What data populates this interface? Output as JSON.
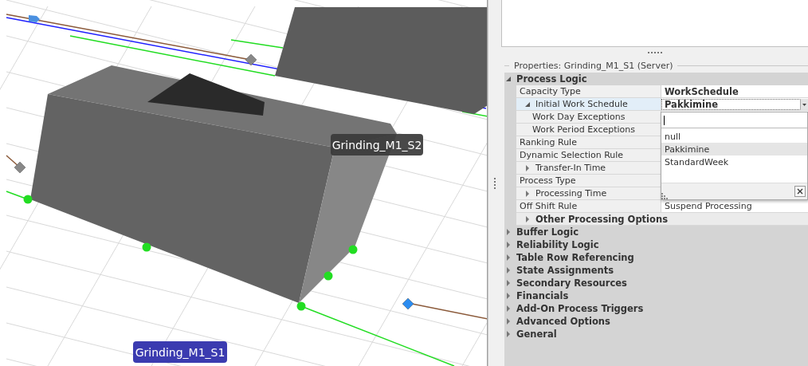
{
  "viewport": {
    "labels": [
      {
        "text": "Grinding_M1_S2",
        "selected": false
      },
      {
        "text": "Grinding_M1_S1",
        "selected": true
      }
    ]
  },
  "properties": {
    "title": "Properties: Grinding_M1_S1 (Server)",
    "categories": [
      {
        "label": "Process Logic",
        "expanded": true,
        "rows": [
          {
            "kind": "property",
            "label": "Capacity Type",
            "value": "WorkSchedule",
            "modified": true,
            "selected": false
          },
          {
            "kind": "property",
            "label": "Initial Work Schedule",
            "value": "Pakkimine",
            "modified": true,
            "selected": true,
            "expanded": true,
            "children": [
              {
                "kind": "property",
                "label": "Work Day Exceptions",
                "selected": false
              },
              {
                "kind": "property",
                "label": "Work Period Exceptions",
                "selected": false
              }
            ]
          },
          {
            "kind": "property",
            "label": "Ranking Rule",
            "selected": false
          },
          {
            "kind": "property",
            "label": "Dynamic Selection Rule",
            "selected": false
          },
          {
            "kind": "property",
            "label": "Transfer-In Time",
            "selected": false,
            "expanded": false
          },
          {
            "kind": "property",
            "label": "Process Type",
            "selected": false
          },
          {
            "kind": "property",
            "label": "Processing Time",
            "selected": false,
            "expanded": false
          },
          {
            "kind": "property",
            "label": "Off Shift Rule",
            "value": "Suspend Processing",
            "modified": false,
            "selected": false
          },
          {
            "kind": "category",
            "label": "Other Processing Options",
            "expanded": false
          }
        ]
      },
      {
        "label": "Buffer Logic",
        "expanded": false
      },
      {
        "label": "Reliability Logic",
        "expanded": false
      },
      {
        "label": "Table Row Referencing",
        "expanded": false
      },
      {
        "label": "State Assignments",
        "expanded": false
      },
      {
        "label": "Secondary Resources",
        "expanded": false
      },
      {
        "label": "Financials",
        "expanded": false
      },
      {
        "label": "Add-On Process Triggers",
        "expanded": false
      },
      {
        "label": "Advanced Options",
        "expanded": false
      },
      {
        "label": "General",
        "expanded": false
      }
    ]
  },
  "dropdown": {
    "options": [
      {
        "label": "null",
        "selected": false
      },
      {
        "label": "Pakkimine",
        "selected": true
      },
      {
        "label": "StandardWeek",
        "selected": false
      }
    ]
  }
}
